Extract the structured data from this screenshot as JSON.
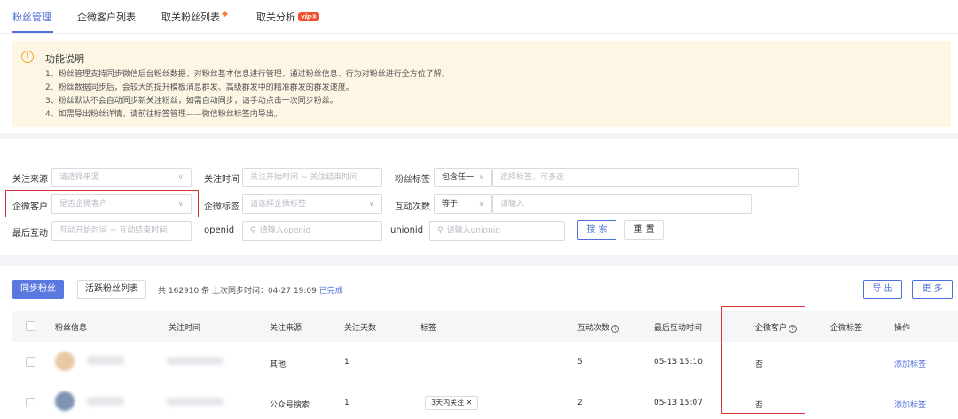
{
  "tabs": [
    {
      "label": "粉丝管理",
      "active": true
    },
    {
      "label": "企微客户列表"
    },
    {
      "label": "取关粉丝列表",
      "icon": "hot-icon"
    },
    {
      "label": "取关分析",
      "badge": "vip",
      "badge_num": "③"
    }
  ],
  "notice": {
    "title": "功能说明",
    "lines": [
      "1、粉丝管理支持同步微信后台粉丝数据，对粉丝基本信息进行管理，通过粉丝信息、行为对粉丝进行全方位了解。",
      "2、粉丝数据同步后，会较大的提升模板消息群发、高级群发中的精准群发的群发速度。",
      "3、粉丝默认不会自动同步新关注粉丝，如需自动同步，请手动点击一次同步粉丝。",
      "4、如需导出粉丝详情，请前往标签管理——微信粉丝标签内导出。"
    ]
  },
  "filters": {
    "source_label": "关注来源",
    "source_placeholder": "请选择来源",
    "follow_time_label": "关注时间",
    "follow_time_placeholder": "关注开始时间 ~ 关注结束时间",
    "fan_tag_label": "粉丝标签",
    "fan_tag_mode": "包含任一",
    "fan_tag_placeholder": "选择标签，可多选",
    "wecom_customer_label": "企微客户",
    "wecom_customer_placeholder": "是否企微客户",
    "wecom_tag_label": "企微标签",
    "wecom_tag_placeholder": "请选择企微标签",
    "interact_count_label": "互动次数",
    "interact_count_op": "等于",
    "interact_count_placeholder": "请输入",
    "last_interact_label": "最后互动",
    "last_interact_placeholder": "互动开始时间 ~ 互动结束时间",
    "openid_label": "openid",
    "openid_placeholder": "请输入openid",
    "unionid_label": "unionid",
    "unionid_placeholder": "请输入unionid",
    "search_button": "搜 索",
    "reset_button": "重 置"
  },
  "toolbar": {
    "sync_button": "同步粉丝",
    "active_list_button": "活跃粉丝列表",
    "summary_prefix": "共 162910 条 上次同步时间：04-27 19:09",
    "summary_status": "已完成",
    "export_button": "导 出",
    "more_button": "更 多"
  },
  "table": {
    "columns": [
      "粉丝信息",
      "关注时间",
      "关注来源",
      "关注天数",
      "标签",
      "互动次数",
      "最后互动时间",
      "企微客户",
      "企微标签",
      "操作"
    ],
    "rows": [
      {
        "source": "其他",
        "days": "1",
        "tag": "",
        "interact": "5",
        "last_time": "05-13 15:10",
        "wecom": "否",
        "wecom_tag": "",
        "action": "添加标签"
      },
      {
        "source": "公众号搜索",
        "days": "1",
        "tag": "3天内关注",
        "interact": "2",
        "last_time": "05-13 15:07",
        "wecom": "否",
        "wecom_tag": "",
        "action": "添加标签"
      }
    ]
  },
  "colors": {
    "accent": "#4f6fd8",
    "highlight_box": "#d8323a",
    "notice_bg": "#fdf6e4"
  }
}
